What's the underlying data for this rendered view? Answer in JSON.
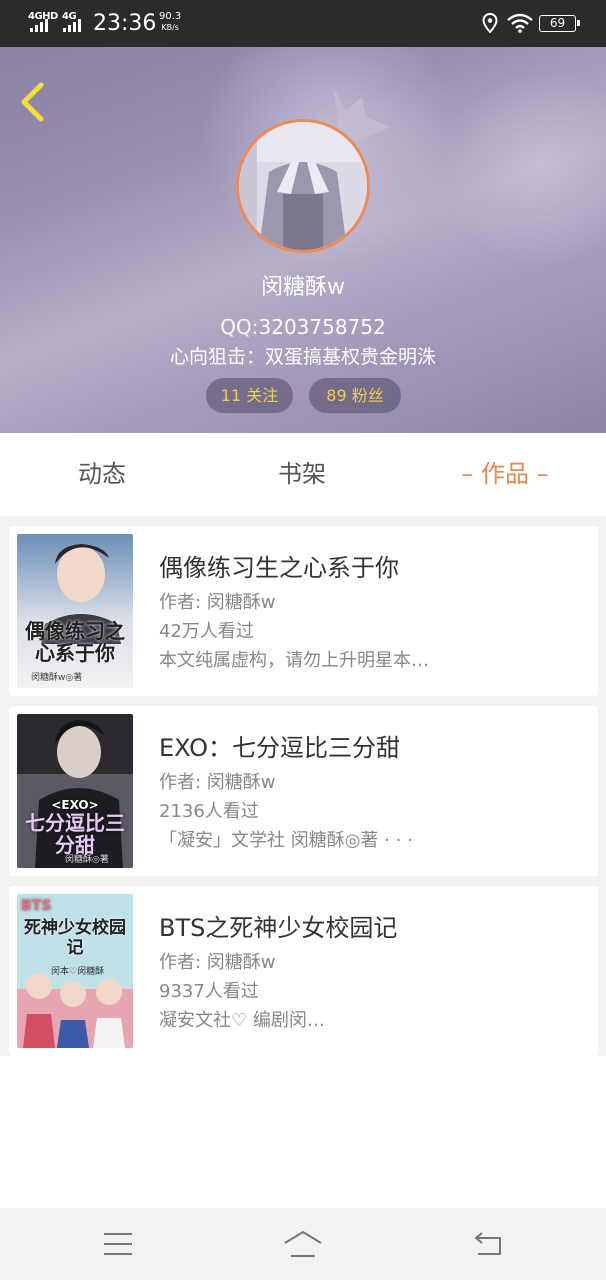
{
  "status_bar": {
    "network1": "4GHD",
    "network2": "4G",
    "time": "23:36",
    "speed_value": "90.3",
    "speed_unit": "KB/s",
    "battery": "69"
  },
  "profile": {
    "username": "闵糖酥w",
    "qq": "QQ:3203758752",
    "bio": "心向狙击：双蛋搞基权贵金明洙",
    "follow_label": "11 关注",
    "fans_label": "89 粉丝"
  },
  "tabs": [
    {
      "label": "动态"
    },
    {
      "label": "书架"
    },
    {
      "label": "– 作品 –",
      "active": true
    }
  ],
  "books": [
    {
      "title": "偶像练习生之心系于你",
      "author": "作者: 闵糖酥w",
      "views": "42万人看过",
      "description": "本文纯属虚构，请勿上升明星本…",
      "cover_text": "偶像练习之心系于你",
      "cover_sub": "闵糖酥w◎著"
    },
    {
      "title": "EXO：七分逗比三分甜",
      "author": "作者: 闵糖酥w",
      "views": "2136人看过",
      "description": "「凝安」文学社     闵糖酥◎著    · · ·",
      "cover_text": "七分逗比三分甜",
      "cover_tag": "<EXO>",
      "cover_sub": "闵糖酥◎著"
    },
    {
      "title": "BTS之死神少女校园记",
      "author": "作者: 闵糖酥w",
      "views": "9337人看过",
      "description": "凝安文社♡ 编剧闵…",
      "cover_text": "死神少女校园记",
      "cover_tag": "BTS",
      "cover_sub": "闵本♡闵糖酥"
    }
  ],
  "colors": {
    "accent": "#e8884e",
    "pill_text": "#f0cf4c",
    "status_bar": "#2b2b2e",
    "header_purple": "#9a91b1"
  },
  "icons": {
    "back": "chevron-left-icon",
    "menu": "menu-icon",
    "home": "home-icon",
    "return": "return-icon"
  }
}
